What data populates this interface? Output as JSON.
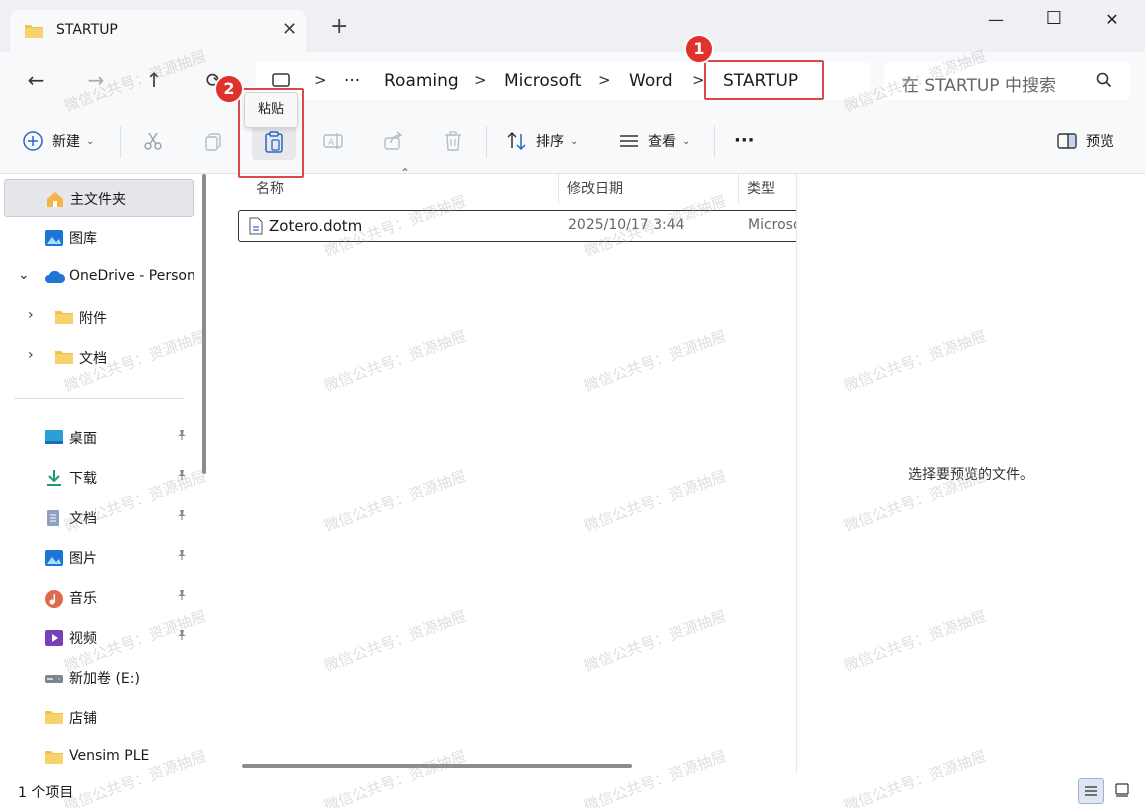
{
  "window": {
    "tab_title": "STARTUP",
    "tab_close": "✕",
    "new_tab": "+",
    "minimize": "—",
    "maximize": "☐",
    "close": "✕"
  },
  "nav": {
    "back": "←",
    "forward": "→",
    "up": "↑",
    "refresh": "⟳"
  },
  "breadcrumb": {
    "overflow": "···",
    "items": [
      "Roaming",
      "Microsoft",
      "Word",
      "STARTUP"
    ],
    "separator": ">"
  },
  "search": {
    "placeholder": "在 STARTUP 中搜索"
  },
  "toolbar": {
    "new_label": "新建",
    "sort_label": "排序",
    "view_label": "查看",
    "more_label": "···",
    "preview_label": "预览",
    "paste_tooltip": "粘贴"
  },
  "sidebar": {
    "items": [
      {
        "label": "主文件夹",
        "icon": "home-icon"
      },
      {
        "label": "图库",
        "icon": "gallery-icon"
      },
      {
        "label": "OneDrive - Personal",
        "icon": "onedrive-icon"
      },
      {
        "label": "附件",
        "icon": "folder-icon"
      },
      {
        "label": "文档",
        "icon": "folder-icon"
      },
      {
        "label": "桌面",
        "icon": "desktop-icon"
      },
      {
        "label": "下载",
        "icon": "download-icon"
      },
      {
        "label": "文档",
        "icon": "documents-icon"
      },
      {
        "label": "图片",
        "icon": "pictures-icon"
      },
      {
        "label": "音乐",
        "icon": "music-icon"
      },
      {
        "label": "视频",
        "icon": "videos-icon"
      },
      {
        "label": "新加卷 (E:)",
        "icon": "drive-icon"
      },
      {
        "label": "店铺",
        "icon": "folder-icon"
      },
      {
        "label": "Vensim PLE",
        "icon": "folder-icon"
      }
    ]
  },
  "columns": [
    "名称",
    "修改日期",
    "类型"
  ],
  "files": [
    {
      "name": "Zotero.dotm",
      "modified": "2025/10/17 3:44",
      "type": "Microsoft Word"
    }
  ],
  "preview": {
    "empty_text": "选择要预览的文件。"
  },
  "status": {
    "item_count": "1 个项目"
  },
  "annotations": {
    "badge_1": "1",
    "badge_2": "2",
    "color": "#e1312c"
  },
  "watermark": "微信公共号：资源抽屉"
}
